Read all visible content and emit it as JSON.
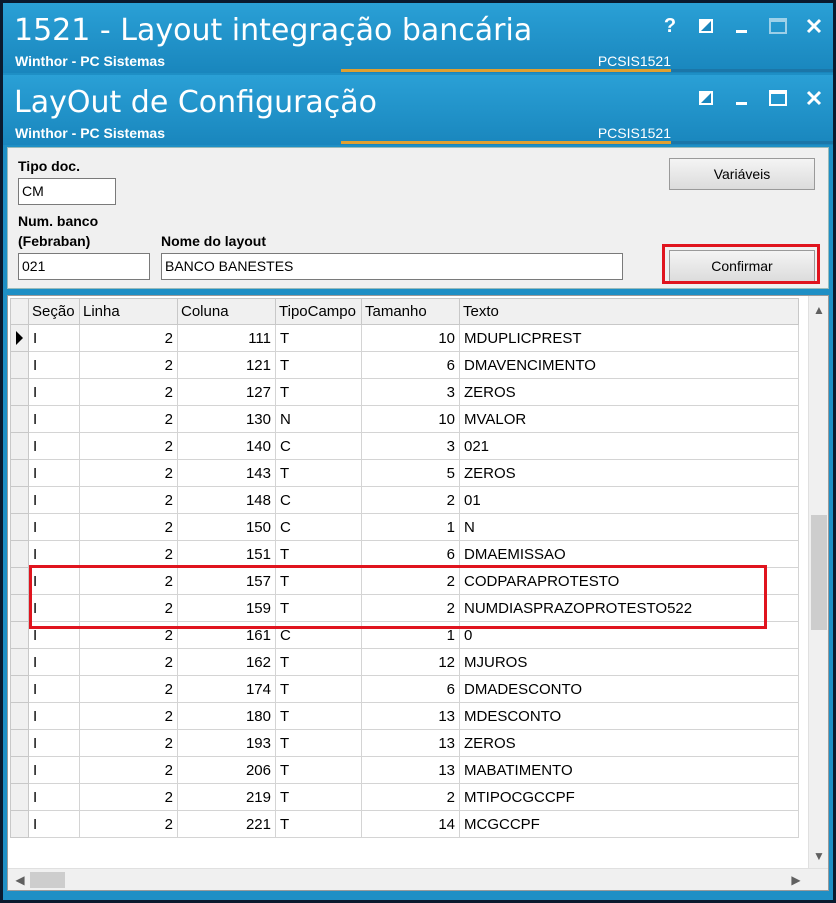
{
  "window": {
    "title": "1521 - Layout integração bancária",
    "subtitle": "Winthor - PC Sistemas",
    "code": "PCSIS1521",
    "help_label": "?"
  },
  "subwindow": {
    "title": "LayOut de Configuração",
    "subtitle": "Winthor - PC Sistemas",
    "code": "PCSIS1521"
  },
  "form": {
    "tipo_doc_label": "Tipo doc.",
    "tipo_doc_value": "CM",
    "num_banco_label_1": "Num. banco",
    "num_banco_label_2": "(Febraban)",
    "num_banco_value": "021",
    "nome_layout_label": "Nome do layout",
    "nome_layout_value": "BANCO BANESTES",
    "variaveis_label": "Variáveis",
    "confirmar_label": "Confirmar"
  },
  "grid": {
    "columns": [
      "Seção",
      "Linha",
      "Coluna",
      "TipoCampo",
      "Tamanho",
      "Texto"
    ],
    "rows": [
      [
        "I",
        "2",
        "111",
        "T",
        "10",
        "MDUPLICPREST"
      ],
      [
        "I",
        "2",
        "121",
        "T",
        "6",
        "DMAVENCIMENTO"
      ],
      [
        "I",
        "2",
        "127",
        "T",
        "3",
        "ZEROS"
      ],
      [
        "I",
        "2",
        "130",
        "N",
        "10",
        "MVALOR"
      ],
      [
        "I",
        "2",
        "140",
        "C",
        "3",
        "021"
      ],
      [
        "I",
        "2",
        "143",
        "T",
        "5",
        "ZEROS"
      ],
      [
        "I",
        "2",
        "148",
        "C",
        "2",
        "01"
      ],
      [
        "I",
        "2",
        "150",
        "C",
        "1",
        "N"
      ],
      [
        "I",
        "2",
        "151",
        "T",
        "6",
        "DMAEMISSAO"
      ],
      [
        "I",
        "2",
        "157",
        "T",
        "2",
        "CODPARAPROTESTO"
      ],
      [
        "I",
        "2",
        "159",
        "T",
        "2",
        "NUMDIASPRAZOPROTESTO522"
      ],
      [
        "I",
        "2",
        "161",
        "C",
        "1",
        "0"
      ],
      [
        "I",
        "2",
        "162",
        "T",
        "12",
        "MJUROS"
      ],
      [
        "I",
        "2",
        "174",
        "T",
        "6",
        "DMADESCONTO"
      ],
      [
        "I",
        "2",
        "180",
        "T",
        "13",
        "MDESCONTO"
      ],
      [
        "I",
        "2",
        "193",
        "T",
        "13",
        "ZEROS"
      ],
      [
        "I",
        "2",
        "206",
        "T",
        "13",
        "MABATIMENTO"
      ],
      [
        "I",
        "2",
        "219",
        "T",
        "2",
        "MTIPOCGCCPF"
      ],
      [
        "I",
        "2",
        "221",
        "T",
        "14",
        "MCGCCPF"
      ]
    ]
  },
  "colors": {
    "titlebar": "#1e8fc5",
    "highlight": "#e0141e",
    "accent_line": "#e0a030"
  }
}
